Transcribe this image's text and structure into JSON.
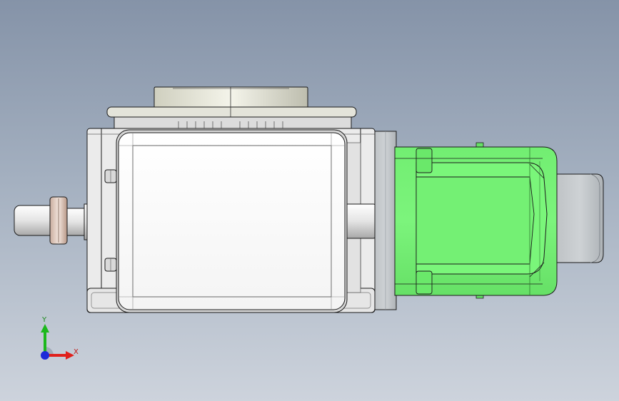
{
  "triad": {
    "x_label": "X",
    "y_label": "Y",
    "colors": {
      "x": "#e0201c",
      "y": "#1cb81c",
      "z": "#1c2ad8"
    }
  },
  "model": {
    "colors": {
      "housing": "#ececec",
      "housing_shade": "#c8c8c8",
      "edge": "#1a1a1a",
      "motor": "#78f078",
      "motor_shade": "#4fc84f",
      "motor_dark": "#3a9a3a",
      "shaft": "#e2e2e2",
      "flange": "#d8c4b8"
    }
  }
}
